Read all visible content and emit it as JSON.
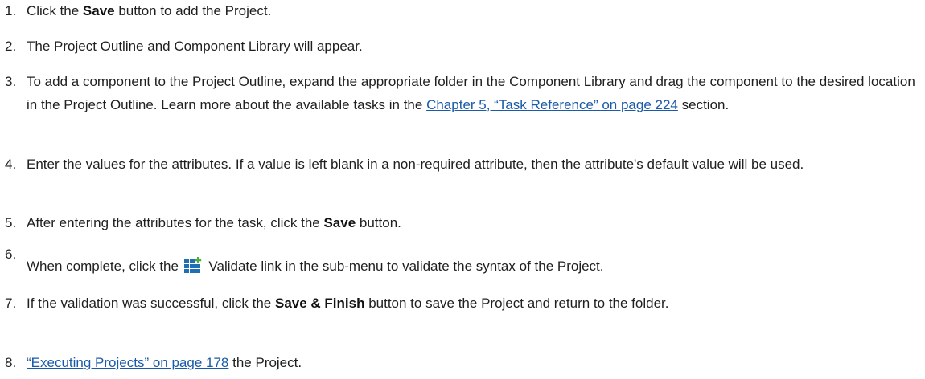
{
  "steps": [
    {
      "number": "1.",
      "pre": "Click the ",
      "bold": "Save",
      "post": " button to add the Project."
    },
    {
      "number": "2.",
      "text": "The Project Outline and Component Library will appear."
    },
    {
      "number": "3.",
      "pre": "To add a component to the Project Outline, expand the appropriate folder in the Component Library and drag the component to the desired location in the Project Outline. Learn more about the available tasks in the ",
      "link": "Chapter 5, “Task Reference” on page 224",
      "post": " section."
    },
    {
      "number": "4.",
      "text": "Enter the values for the attributes. If a value is left blank in a non-required attribute, then the attribute's default value will be used."
    },
    {
      "number": "5.",
      "pre": "After entering the attributes for the task, click the ",
      "bold": "Save",
      "post": " button."
    },
    {
      "number": "6.",
      "pre": "When complete, click the ",
      "icon": "validate-icon",
      "post": " Validate link in the sub-menu to validate the syntax of the Project."
    },
    {
      "number": "7.",
      "pre": "If the validation was successful, click the ",
      "bold": "Save & Finish",
      "post": " button to save the Project and return to the folder."
    },
    {
      "number": "8.",
      "link": "“Executing Projects” on page 178",
      "post": " the Project."
    }
  ],
  "colors": {
    "text": "#1f1f1f",
    "link": "#1a5aa8",
    "icon_blue": "#1f6fb5",
    "icon_green": "#4caf3d"
  }
}
